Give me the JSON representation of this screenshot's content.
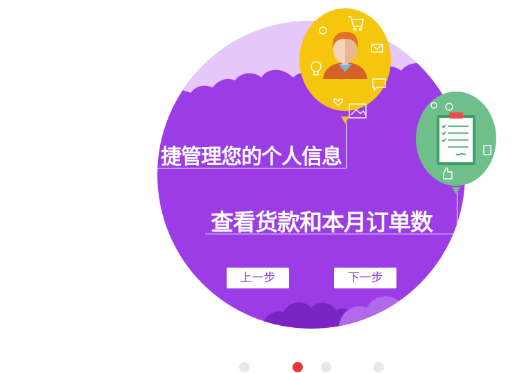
{
  "slide": {
    "line1": "捷管理您的个人信息",
    "line2": "查看货款和本月订单数"
  },
  "buttons": {
    "prev_label": "上一步",
    "next_label": "下一步"
  },
  "pagination": {
    "count": 4,
    "active_index": 1
  },
  "colors": {
    "circle": "#9b3ce6",
    "cloud_top": "#e6c8f8",
    "cloud_bottom": "#7a24c4",
    "balloon_yellow": "#f6c60e",
    "balloon_green": "#6fbf8a",
    "dot_active": "#e8383c",
    "dot_inactive": "#e8e8e8"
  },
  "icons": [
    "cart-icon",
    "user-avatar-icon",
    "checklist-icon",
    "lightbulb-icon",
    "envelope-icon",
    "heart-icon",
    "image-icon",
    "thumbs-up-icon",
    "smiley-icon",
    "chat-icon"
  ]
}
